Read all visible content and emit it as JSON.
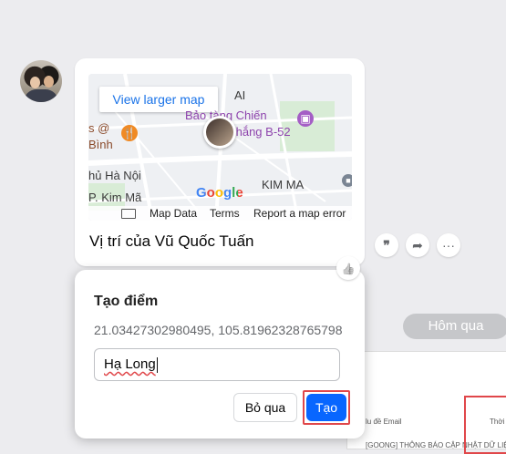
{
  "map": {
    "view_larger": "View larger map",
    "labels": {
      "ai": "AI",
      "bao_tang": "Bảo tàng Chiến",
      "thang": "thắng B-52",
      "binh_prefix": "s @",
      "binh": "Bình",
      "ha_noi": "hủ Hà Nội",
      "kim_ma": "KIM MA",
      "p_kim_ma": "P. Kim Mã"
    },
    "google_logo": "Google",
    "footer": {
      "map_data": "Map Data",
      "terms": "Terms",
      "report": "Report a map error"
    }
  },
  "message": {
    "location_title": "Vị trí của Vũ Quốc Tuấn"
  },
  "actions": {
    "quote_icon": "❞",
    "share_icon": "➦",
    "more_icon": "···",
    "like_icon": "👍"
  },
  "date_separator": "Hôm qua",
  "background_doc": {
    "col1": "lu đề Email",
    "col2": "Thời",
    "row1": "[GOONG] THÔNG BÁO CẬP NHẬT DỮ LIỆU"
  },
  "popup": {
    "title": "Tạo điểm",
    "coordinates": "21.03427302980495, 105.81962328765798",
    "input_value": "Hạ Long",
    "skip_label": "Bỏ qua",
    "create_label": "Tạo"
  },
  "colors": {
    "primary": "#0866ff",
    "highlight": "#e0474a",
    "link": "#1a73e8"
  }
}
